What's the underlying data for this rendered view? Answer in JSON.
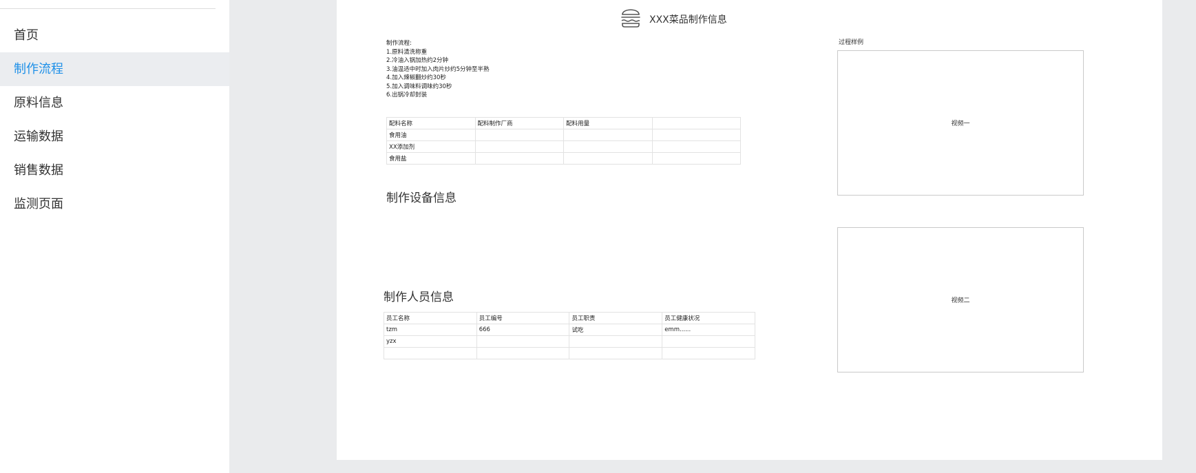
{
  "sidebar": {
    "items": [
      {
        "label": "首页",
        "active": false
      },
      {
        "label": "制作流程",
        "active": true
      },
      {
        "label": "原料信息",
        "active": false
      },
      {
        "label": "运输数据",
        "active": false
      },
      {
        "label": "销售数据",
        "active": false
      },
      {
        "label": "监测页面",
        "active": false
      }
    ],
    "active_color": "#1e90e8"
  },
  "header": {
    "icon": "burger-icon",
    "title": "XXX菜品制作信息"
  },
  "process": {
    "heading": "制作流程:",
    "steps": [
      "1.原料清洗称重",
      "2.冷油入锅加热约2分钟",
      "3.油温适中时加入肉片炒约5分钟至半熟",
      "4.加入辣椒翻炒约30秒",
      "5.加入调味料调味约30秒",
      "6.出锅冷却封装"
    ]
  },
  "ingredients_table": {
    "headers": [
      "配料名称",
      "配料制作厂商",
      "配料用量",
      ""
    ],
    "rows": [
      [
        "食用油",
        "",
        "",
        ""
      ],
      [
        "XX添加剂",
        "",
        "",
        ""
      ],
      [
        "食用盐",
        "",
        "",
        ""
      ]
    ]
  },
  "equipment": {
    "title": "制作设备信息"
  },
  "staff": {
    "title": "制作人员信息",
    "headers": [
      "员工名称",
      "员工编号",
      "员工职责",
      "员工健康状况"
    ],
    "rows": [
      [
        "tzm",
        "666",
        "试吃",
        "emm......"
      ],
      [
        "yzx",
        "",
        "",
        ""
      ],
      [
        "",
        "",
        "",
        ""
      ]
    ]
  },
  "samples": {
    "label": "过程样例",
    "videos": [
      "视频一",
      "视频二"
    ]
  }
}
